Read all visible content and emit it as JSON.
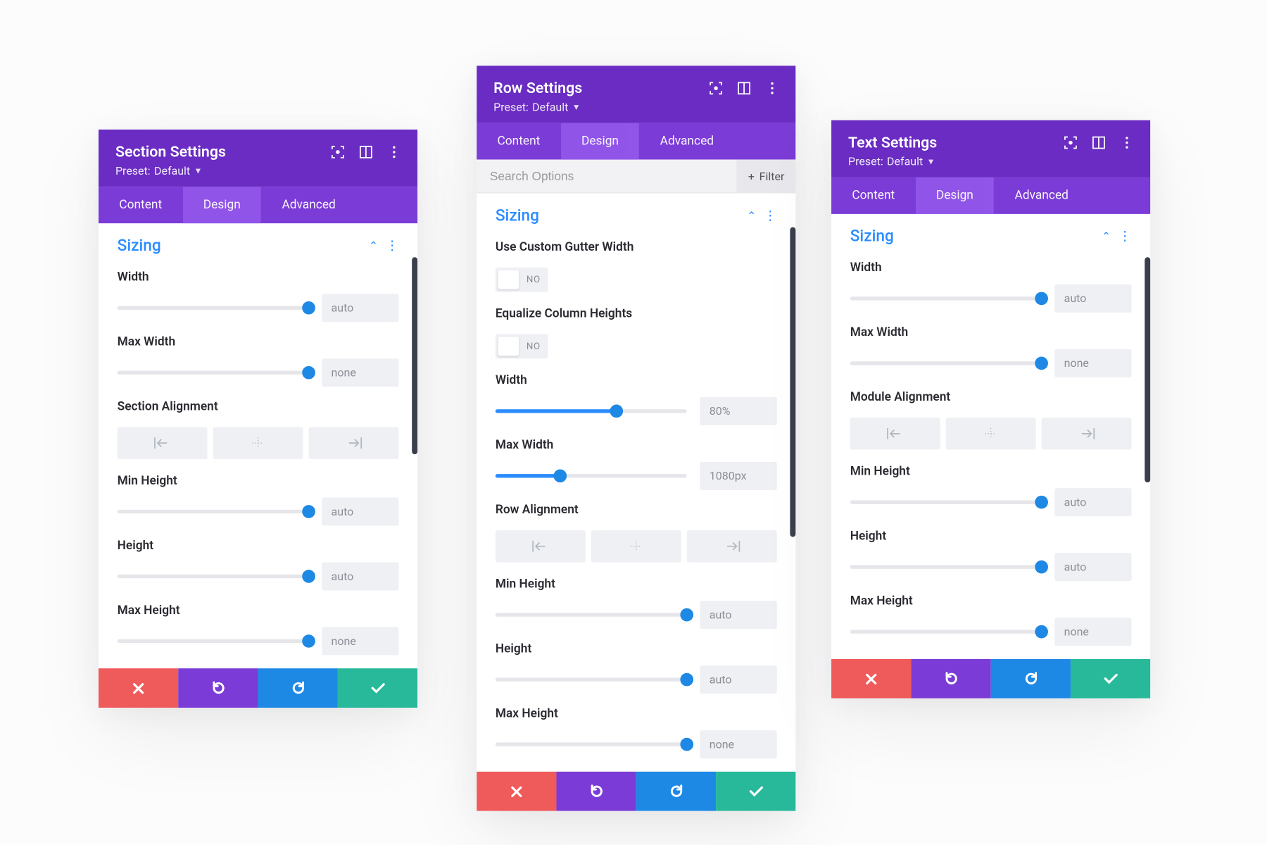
{
  "common": {
    "tabs": {
      "content": "Content",
      "design": "Design",
      "advanced": "Advanced"
    },
    "preset_prefix": "Preset: ",
    "preset_name": "Default",
    "sizing_heading": "Sizing",
    "search_placeholder": "Search Options",
    "filter_label": "Filter",
    "toggle_no": "NO"
  },
  "panels": {
    "section": {
      "title": "Section Settings",
      "alignment_label": "Section Alignment",
      "sliders": {
        "width": {
          "label": "Width",
          "value": "auto",
          "pos": 100
        },
        "max_width": {
          "label": "Max Width",
          "value": "none",
          "pos": 100
        },
        "min_height": {
          "label": "Min Height",
          "value": "auto",
          "pos": 100
        },
        "height": {
          "label": "Height",
          "value": "auto",
          "pos": 100
        },
        "max_height": {
          "label": "Max Height",
          "value": "none",
          "pos": 100
        }
      }
    },
    "row": {
      "title": "Row Settings",
      "gutter_label": "Use Custom Gutter Width",
      "equalize_label": "Equalize Column Heights",
      "alignment_label": "Row Alignment",
      "sliders": {
        "width": {
          "label": "Width",
          "value": "80%",
          "pos": 63
        },
        "max_width": {
          "label": "Max Width",
          "value": "1080px",
          "pos": 34
        },
        "min_height": {
          "label": "Min Height",
          "value": "auto",
          "pos": 100
        },
        "height": {
          "label": "Height",
          "value": "auto",
          "pos": 100
        },
        "max_height": {
          "label": "Max Height",
          "value": "none",
          "pos": 100
        }
      }
    },
    "text": {
      "title": "Text Settings",
      "alignment_label": "Module Alignment",
      "sliders": {
        "width": {
          "label": "Width",
          "value": "auto",
          "pos": 100
        },
        "max_width": {
          "label": "Max Width",
          "value": "none",
          "pos": 100
        },
        "min_height": {
          "label": "Min Height",
          "value": "auto",
          "pos": 100
        },
        "height": {
          "label": "Height",
          "value": "auto",
          "pos": 100
        },
        "max_height": {
          "label": "Max Height",
          "value": "none",
          "pos": 100
        }
      }
    }
  }
}
